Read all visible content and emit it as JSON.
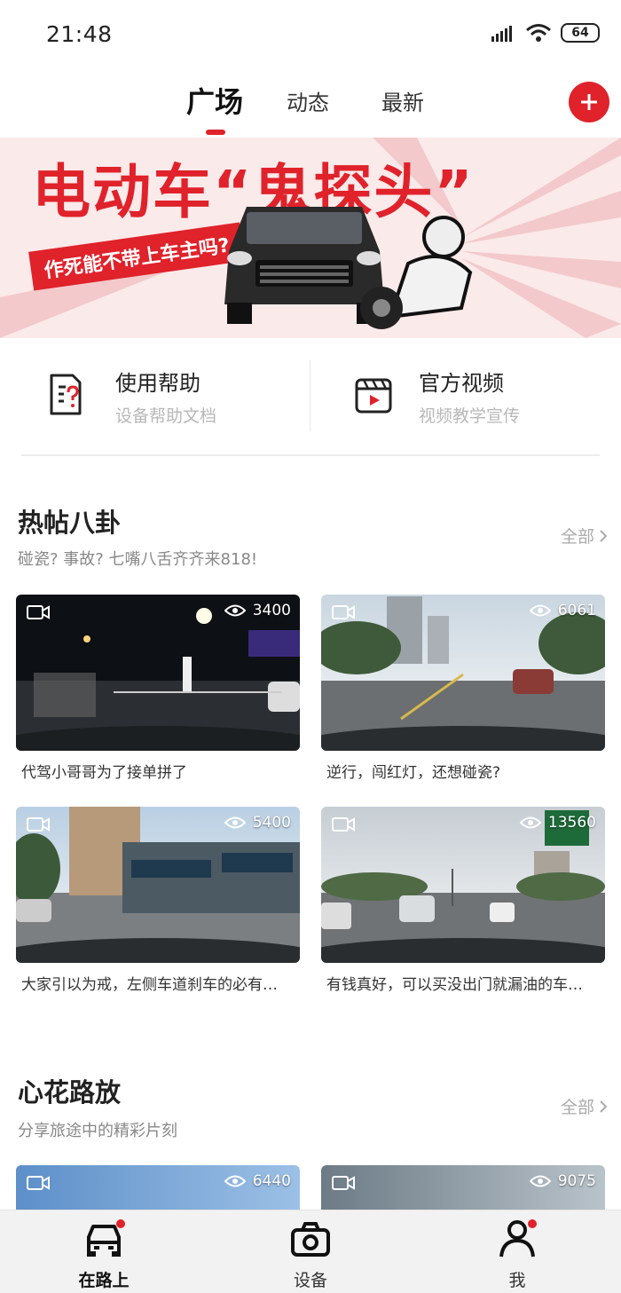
{
  "status_bar": {
    "time": "21:48",
    "battery": "64"
  },
  "top_tabs": [
    {
      "label": "广场",
      "active": true
    },
    {
      "label": "动态",
      "active": false
    },
    {
      "label": "最新",
      "active": false
    }
  ],
  "banner": {
    "headline": "电动车“鬼探头”",
    "tagline": "作死能不带上车主吗?"
  },
  "quick_links": [
    {
      "title": "使用帮助",
      "subtitle": "设备帮助文档",
      "icon": "help-document-icon"
    },
    {
      "title": "官方视频",
      "subtitle": "视频教学宣传",
      "icon": "video-play-icon"
    }
  ],
  "sections": [
    {
      "title": "热帖八卦",
      "subtitle": "碰瓷? 事故? 七嘴八舌齐齐来818!",
      "see_all": "全部",
      "cards": [
        {
          "views": "3400",
          "caption": "代驾小哥哥为了接单拼了"
        },
        {
          "views": "6061",
          "caption": "逆行，闯红灯，还想碰瓷?"
        },
        {
          "views": "5400",
          "caption": "大家引以为戒，左侧车道刹车的必有…"
        },
        {
          "views": "13560",
          "caption": "有钱真好，可以买没出门就漏油的车…"
        }
      ]
    },
    {
      "title": "心花路放",
      "subtitle": "分享旅途中的精彩片刻",
      "see_all": "全部",
      "cards": [
        {
          "views": "6440"
        },
        {
          "views": "9075"
        }
      ]
    }
  ],
  "bottom_nav": [
    {
      "label": "在路上",
      "icon": "car-icon",
      "active": true,
      "dot": true
    },
    {
      "label": "设备",
      "icon": "camera-icon",
      "active": false,
      "dot": false
    },
    {
      "label": "我",
      "icon": "person-icon",
      "active": false,
      "dot": true
    }
  ],
  "colors": {
    "accent": "#e0222b",
    "muted_text": "#b8b8b8"
  }
}
